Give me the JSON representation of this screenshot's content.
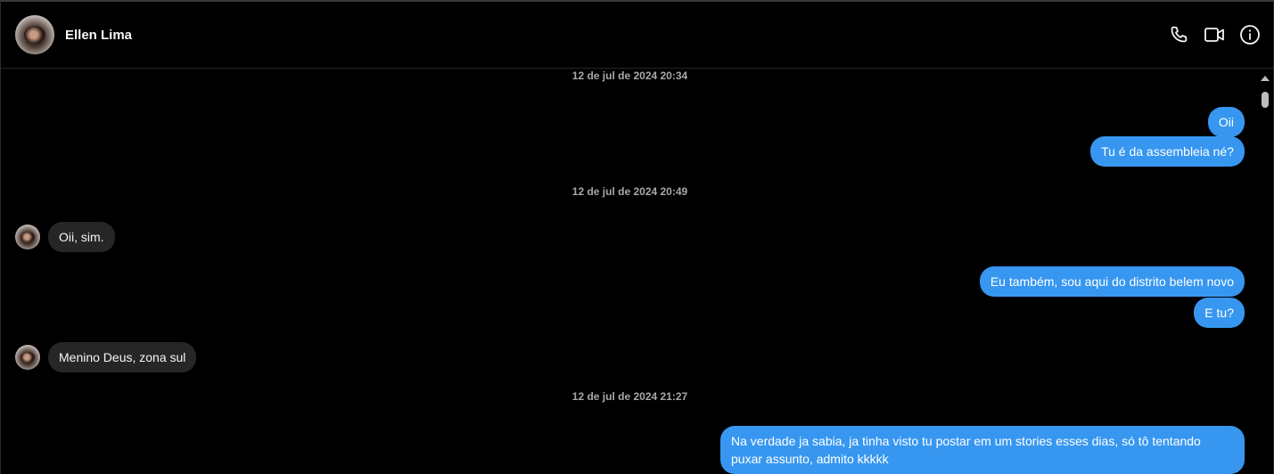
{
  "header": {
    "contact_name": "Ellen Lima",
    "actions": [
      "phone-icon",
      "video-icon",
      "info-icon"
    ]
  },
  "colors": {
    "sent_bubble": "#3797f0",
    "received_bubble": "#262626",
    "background": "#000000"
  },
  "thread": {
    "timestamps": [
      "12 de jul de 2024 20:34",
      "12 de jul de 2024 20:49",
      "12 de jul de 2024 21:27"
    ],
    "messages": [
      {
        "direction": "sent",
        "text": "Oii"
      },
      {
        "direction": "sent",
        "text": "Tu é da assembleia né?"
      },
      {
        "direction": "received",
        "text": "Oii, sim."
      },
      {
        "direction": "sent",
        "text": "Eu também, sou aqui do distrito belem novo"
      },
      {
        "direction": "sent",
        "text": "E tu?"
      },
      {
        "direction": "received",
        "text": "Menino Deus, zona sul"
      },
      {
        "direction": "sent",
        "text": "Na verdade ja sabia, ja tinha visto tu postar em um stories esses dias, só tô tentando puxar assunto, admito kkkkk"
      }
    ]
  }
}
